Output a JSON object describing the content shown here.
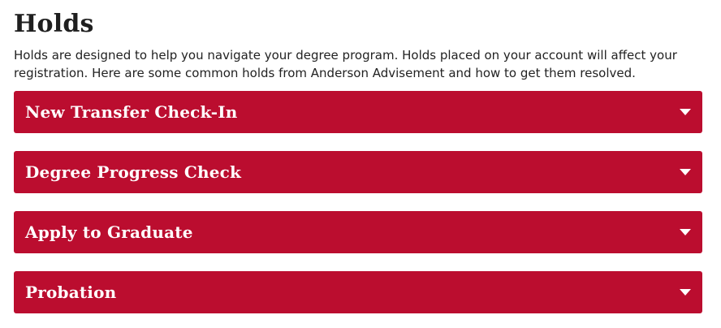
{
  "page": {
    "title": "Holds",
    "intro": "Holds are designed to help you navigate your degree program. Holds placed on your account will affect your registration. Here are some common holds from Anderson Advisement and how to get them resolved."
  },
  "accordion": {
    "items": [
      {
        "label": "New Transfer Check-In",
        "expanded": false
      },
      {
        "label": "Degree Progress Check",
        "expanded": false
      },
      {
        "label": "Apply to Graduate",
        "expanded": false
      },
      {
        "label": "Probation",
        "expanded": false
      }
    ]
  },
  "colors": {
    "accordion_bg": "#bb0d2f",
    "accordion_text": "#ffffff",
    "body_text": "#222222"
  },
  "icons": {
    "toggle": "chevron-down-icon"
  }
}
